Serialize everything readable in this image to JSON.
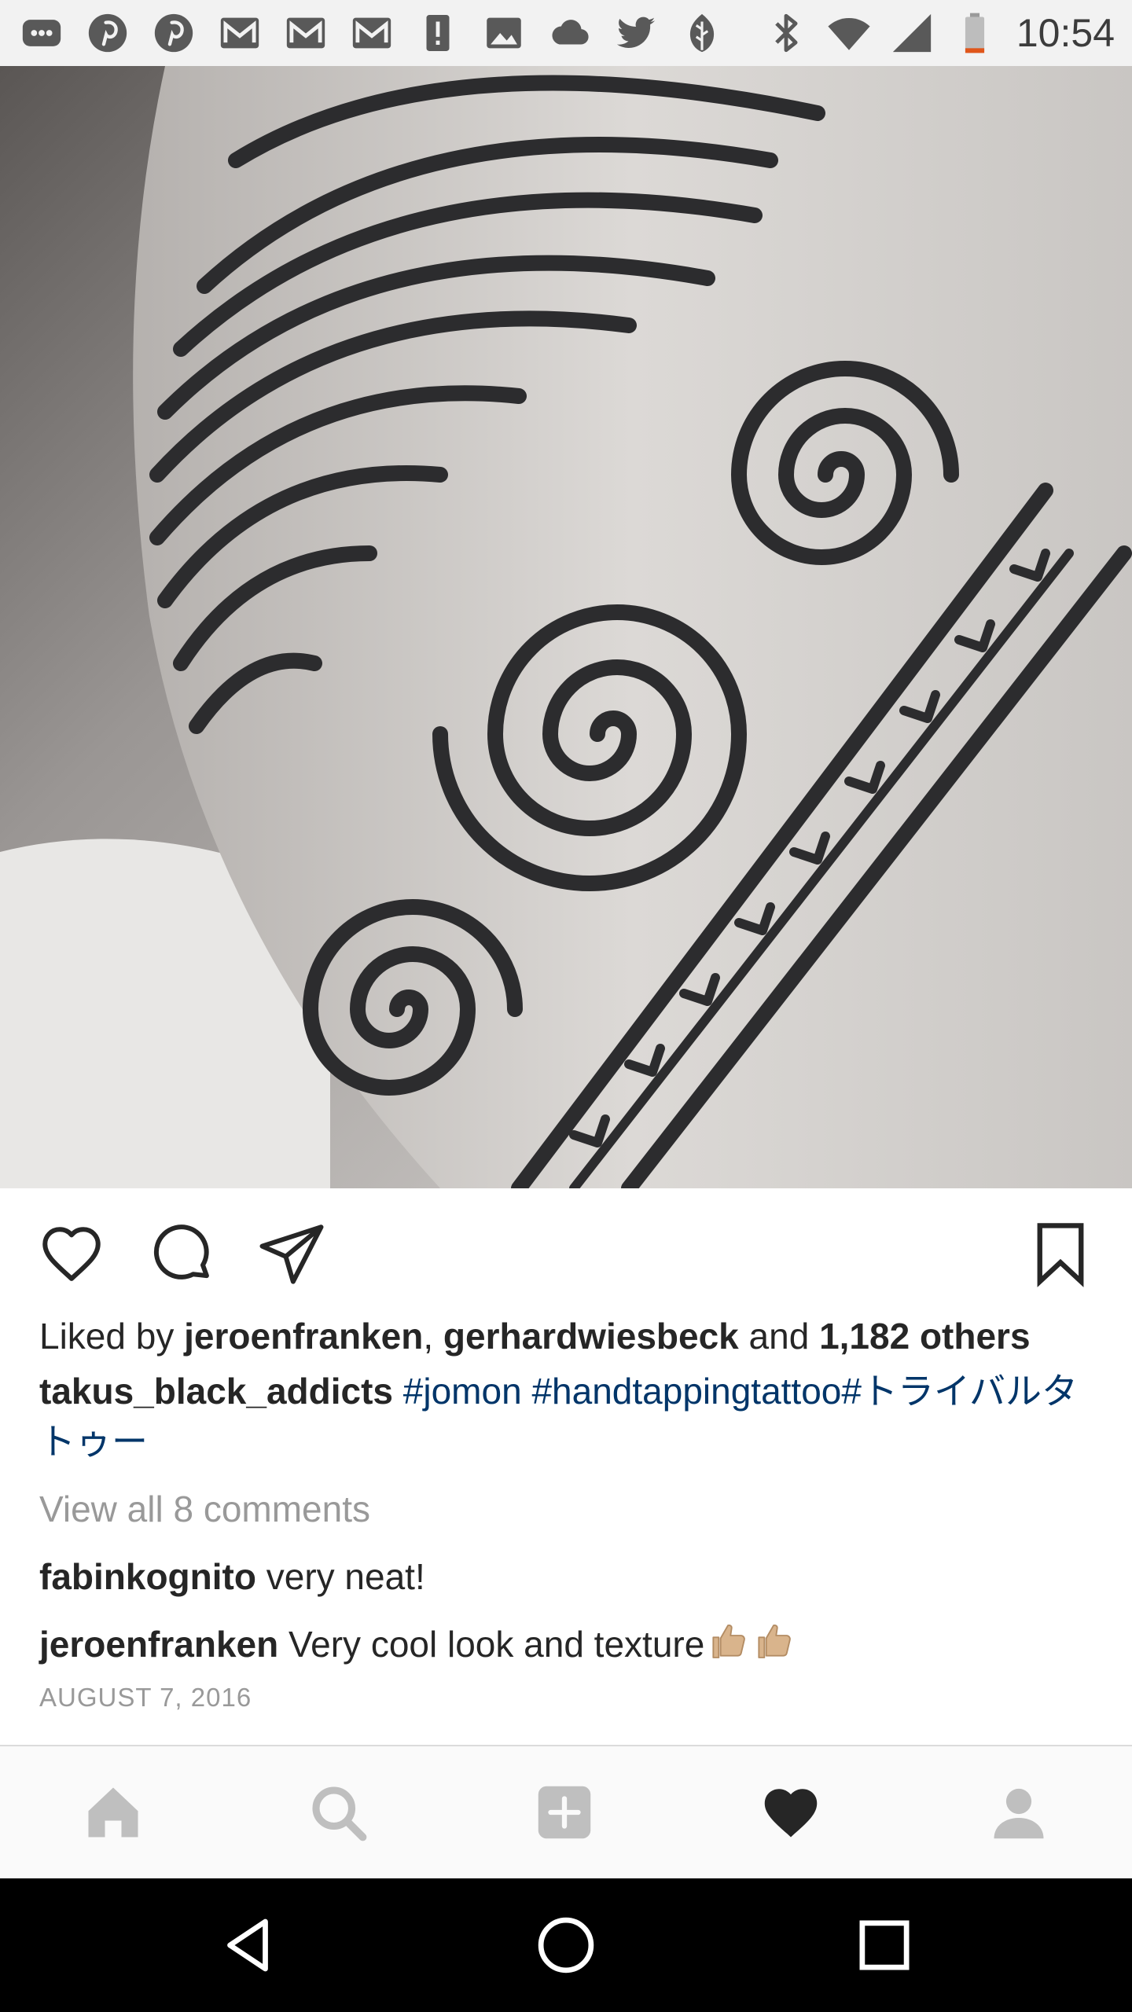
{
  "status_bar": {
    "time": "10:54",
    "icons_left": [
      "messages-icon",
      "pinterest-icon",
      "pinterest-icon",
      "gmail-icon",
      "gmail-icon",
      "gmail-icon",
      "alert-icon",
      "image-icon",
      "cloud-icon",
      "twitter-icon",
      "leaf-icon"
    ],
    "icons_right": [
      "bluetooth-icon",
      "wifi-icon",
      "cell-signal-icon",
      "battery-low-icon"
    ]
  },
  "post": {
    "image_subject": "tattoo-photo",
    "likes": {
      "prefix": "Liked by ",
      "user1": "jeroenfranken",
      "separator": ", ",
      "user2": "gerhardwiesbeck",
      "conjunction": " and ",
      "others": "1,182 others"
    },
    "caption": {
      "username": "takus_black_addicts",
      "hashtag1": "#jomon",
      "hashtag2": "#handtappingtattoo",
      "hashtag3": "#トライバルタトゥー"
    },
    "view_all_comments": "View all 8 comments",
    "comments": [
      {
        "username": "fabinkognito",
        "text": "very neat!"
      },
      {
        "username": "jeroenfranken",
        "text": "Very cool look and texture"
      }
    ],
    "date": "AUGUST 7, 2016"
  },
  "tab_bar": {
    "items": [
      "home-icon",
      "search-icon",
      "new-post-icon",
      "activity-heart-icon",
      "profile-icon"
    ],
    "active": "activity-heart-icon"
  },
  "nav_bar": {
    "items": [
      "back-icon",
      "home-circle-icon",
      "recents-icon"
    ]
  },
  "colors": {
    "text": "#262626",
    "hashtag": "#003569",
    "muted": "#999999",
    "tab_inactive": "#bfbfbf",
    "tab_active": "#262626"
  }
}
